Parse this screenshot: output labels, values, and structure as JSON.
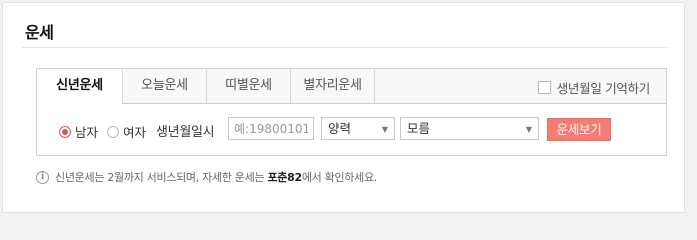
{
  "widget": {
    "title": "운세"
  },
  "tabs": [
    {
      "label": "신년운세",
      "active": true
    },
    {
      "label": "오늘운세",
      "active": false
    },
    {
      "label": "띠별운세",
      "active": false
    },
    {
      "label": "별자리운세",
      "active": false
    }
  ],
  "remember": {
    "label": "생년월일 기억하기",
    "checked": false
  },
  "form": {
    "gender": {
      "male_label": "남자",
      "female_label": "여자",
      "selected": "male"
    },
    "dob_label": "생년월일시",
    "dob_placeholder": "예:19800101",
    "calendar_select": "양력",
    "time_select": "모름",
    "submit_label": "운세보기"
  },
  "notice": {
    "icon": "info-icon",
    "text_before": "신년운세는 2월까지 서비스되며, 자세한 운세는 ",
    "highlight": "포춘82",
    "text_after": "에서 확인하세요."
  },
  "colors": {
    "accent": "#f47c74",
    "radio_checked": "#e2554d"
  }
}
